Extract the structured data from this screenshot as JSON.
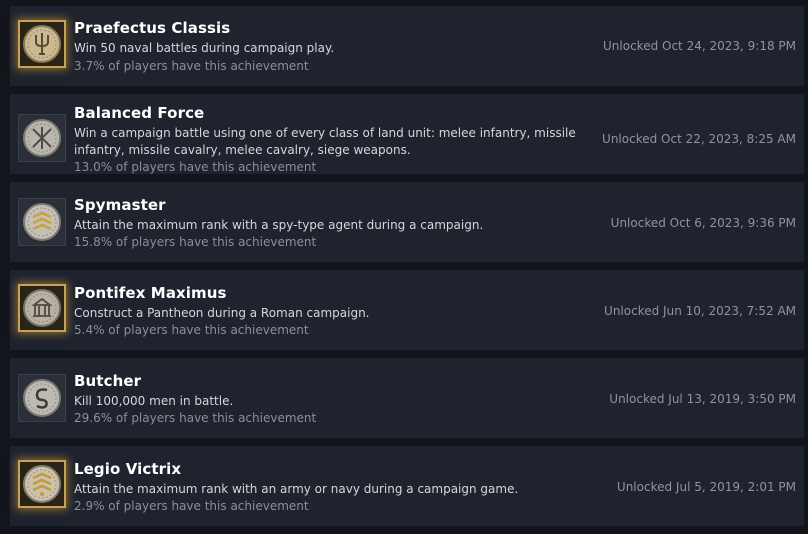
{
  "achievements": [
    {
      "title": "Praefectus Classis",
      "description": "Win 50 naval battles during campaign play.",
      "percent": "3.7% of players have this achievement",
      "unlocked": "Unlocked Oct 24, 2023, 9:18 PM",
      "icon": "trident-coin-icon",
      "rare": true
    },
    {
      "title": "Balanced Force",
      "description": "Win a campaign battle using one of every class of land unit: melee infantry, missile infantry, missile cavalry, melee cavalry, siege weapons.",
      "percent": "13.0% of players have this achievement",
      "unlocked": "Unlocked Oct 22, 2023, 8:25 AM",
      "icon": "crossed-weapons-coin-icon",
      "rare": false
    },
    {
      "title": "Spymaster",
      "description": "Attain the maximum rank with a spy-type agent during a campaign.",
      "percent": "15.8% of players have this achievement",
      "unlocked": "Unlocked Oct 6, 2023, 9:36 PM",
      "icon": "rank-chevrons-coin-icon",
      "rare": false
    },
    {
      "title": "Pontifex Maximus",
      "description": "Construct a Pantheon during a Roman campaign.",
      "percent": "5.4% of players have this achievement",
      "unlocked": "Unlocked Jun 10, 2023, 7:52 AM",
      "icon": "temple-coin-icon",
      "rare": true
    },
    {
      "title": "Butcher",
      "description": "Kill 100,000 men in battle.",
      "percent": "29.6% of players have this achievement",
      "unlocked": "Unlocked Jul 13, 2019, 3:50 PM",
      "icon": "serpent-coin-icon",
      "rare": false
    },
    {
      "title": "Legio Victrix",
      "description": "Attain the maximum rank with an army or navy during a campaign game.",
      "percent": "2.9% of players have this achievement",
      "unlocked": "Unlocked Jul 5, 2019, 2:01 PM",
      "icon": "rank-chevrons-coin-icon",
      "rare": true
    }
  ],
  "colors": {
    "background": "#12151b",
    "row": "#1e232d",
    "title": "#ffffff",
    "description": "#d4d7dc",
    "muted": "#8a909a",
    "rare_glow": "#c8a154"
  }
}
